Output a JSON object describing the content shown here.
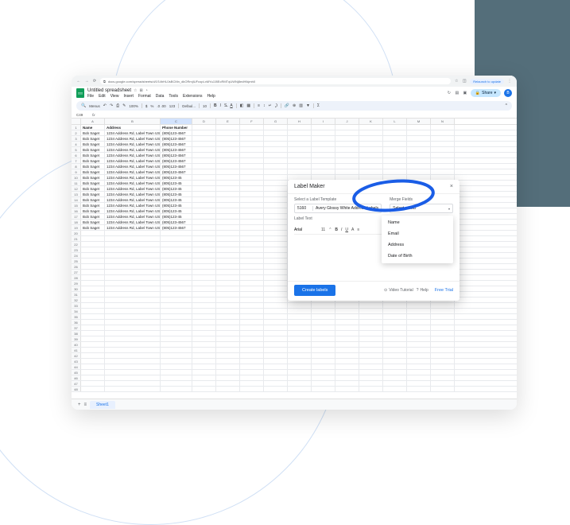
{
  "browser": {
    "url": "docs.google.com/spreadsheets/d/1S4hHUJsBCMn_dkORmjIUFcopLxMYoJJ8EcRMTqUWNj8edHIkjmh0",
    "update_button": "Relaunch to update"
  },
  "doc": {
    "title": "Untitled spreadsheet",
    "share": "Share",
    "avatar_initial": "B"
  },
  "menu": [
    "File",
    "Edit",
    "View",
    "Insert",
    "Format",
    "Data",
    "Tools",
    "Extensions",
    "Help"
  ],
  "toolbar": {
    "menus_label": "Menus",
    "zoom": "100%",
    "currency": "$",
    "percent": "%",
    "decimals": ".0 .00",
    "format_num": "123",
    "font": "Defaul...",
    "size": "10"
  },
  "formula": {
    "cell": "C49",
    "fx": "fx"
  },
  "columns": [
    "A",
    "B",
    "C",
    "D",
    "E",
    "F",
    "G",
    "H",
    "I",
    "J",
    "K",
    "L",
    "M",
    "N"
  ],
  "headers": {
    "name": "Name",
    "address": "Address",
    "phone": "Phone Number"
  },
  "row_data": {
    "name": "Bob Saget",
    "address": "1234 Address Rd, Label Town USA",
    "phone": "(805)123-4567",
    "phone_cut": "(805)123-45"
  },
  "row_count": 48,
  "data_rows": 18,
  "sheet_tab": "Sheet1",
  "panel": {
    "title": "Label Maker",
    "template_label": "Select a Label Template",
    "template_code": "5160",
    "template_name": "Avery Glossy White Address Labels",
    "merge_label": "Merge Fields",
    "merge_placeholder": "Select a field",
    "text_label": "Label Text",
    "font": "Arial",
    "font_size": "11",
    "create": "Create labels",
    "video": "Video Tutorial",
    "help": "Help",
    "trial": "Free Trial"
  },
  "dropdown_items": [
    "Name",
    "Email",
    "Address",
    "Date of Birth"
  ]
}
